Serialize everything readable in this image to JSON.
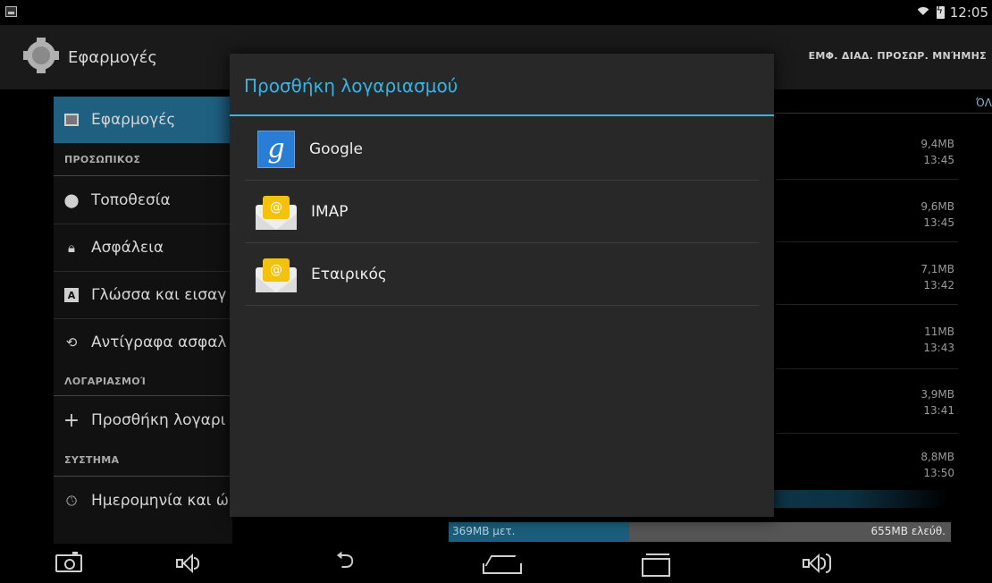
{
  "status_bar": {
    "time": "12:05"
  },
  "action_bar": {
    "title": "Εφαρμογές",
    "tabs": "ΕΜΦ. ΔΙΑΔ. ΠΡΟΣΩΡ. ΜΝΉΜΗΣ"
  },
  "left_pane": {
    "selected": "Εφαρμογές",
    "section_personal": "ΠΡΟΣΩΠΙΚΟΣ",
    "location": "Τοποθεσία",
    "security": "Ασφάλεια",
    "language": "Γλώσσα και εισαγ",
    "backup": "Αντίγραφα ασφαλ",
    "section_accounts": "ΛΟΓΑΡΙΑΣΜΟΊ",
    "add_account": "Προσθήκη λογαρι",
    "section_system": "ΣΥΣΤΗΜΑ",
    "datetime": "Ημερομηνία και ώ"
  },
  "right_pane": {
    "column_header": "ΌΛ",
    "rows": [
      {
        "size": "9,4MB",
        "time": "13:45"
      },
      {
        "size": "9,6MB",
        "time": "13:45"
      },
      {
        "size": "7,1MB",
        "time": "13:42"
      },
      {
        "size": "11MB",
        "time": "13:43"
      },
      {
        "size": "3,9MB",
        "time": "13:41"
      },
      {
        "size": "8,8MB",
        "time": "13:50"
      }
    ],
    "storage_used": "369MB μετ.",
    "storage_free": "655MB ελεύθ.",
    "storage_used_fraction": 0.36
  },
  "dialog": {
    "title": "Προσθήκη λογαριασμού",
    "accounts": [
      {
        "label": "Google",
        "icon": "google-icon"
      },
      {
        "label": "IMAP",
        "icon": "email-icon"
      },
      {
        "label": "Εταιρικός",
        "icon": "email-icon"
      }
    ]
  },
  "colors": {
    "accent": "#33b5e5",
    "selected_bg": "#1f5f80",
    "dialog_bg": "#282828"
  }
}
